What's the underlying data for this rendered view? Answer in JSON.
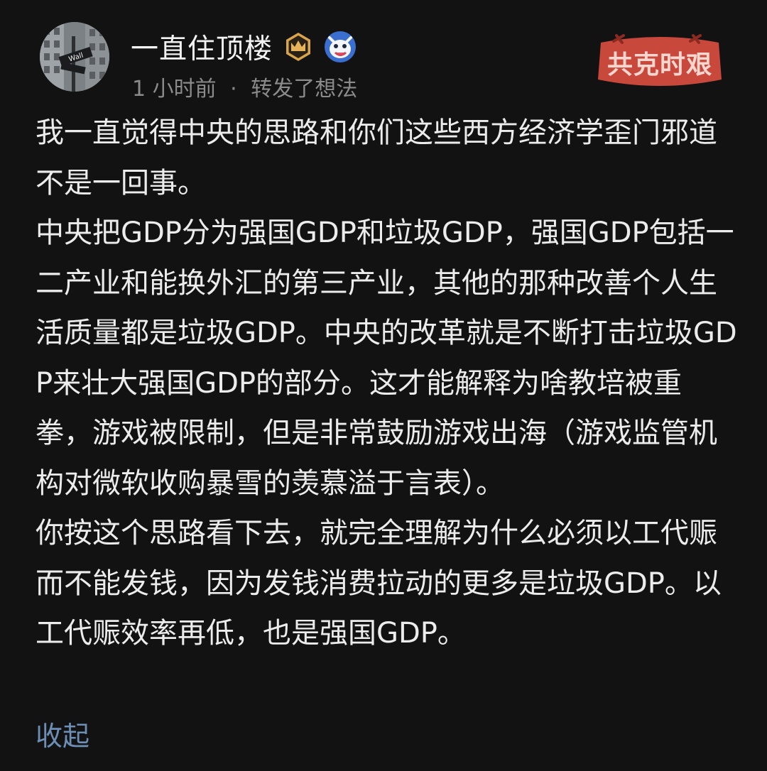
{
  "post": {
    "author": {
      "name": "一直住顶楼",
      "avatar_icon": "wall-street-sign-avatar",
      "avatar_sign_text": "Wall",
      "badges": [
        "crown-badge-icon",
        "creature-badge-icon"
      ]
    },
    "time": "1 小时前",
    "separator": "·",
    "action": "转发了想法",
    "stamp_text": "共克时艰",
    "body": "我一直觉得中央的思路和你们这些西方经济学歪门邪道不是一回事。\n中央把GDP分为强国GDP和垃圾GDP，强国GDP包括一二产业和能换外汇的第三产业，其他的那种改善个人生活质量都是垃圾GDP。中央的改革就是不断打击垃圾GDP来壮大强国GDP的部分。这才能解释为啥教培被重拳，游戏被限制，但是非常鼓励游戏出海（游戏监管机构对微软收购暴雪的羡慕溢于言表）。\n你按这个思路看下去，就完全理解为什么必须以工代赈而不能发钱，因为发钱消费拉动的更多是垃圾GDP。以工代赈效率再低，也是强国GDP。",
    "collapse_label": "收起"
  },
  "colors": {
    "background": "#121212",
    "text": "#ececec",
    "meta": "#8b8b8b",
    "link": "#6e8fb5",
    "stamp": "#c8483b",
    "crown_badge": "#d9a54a"
  }
}
